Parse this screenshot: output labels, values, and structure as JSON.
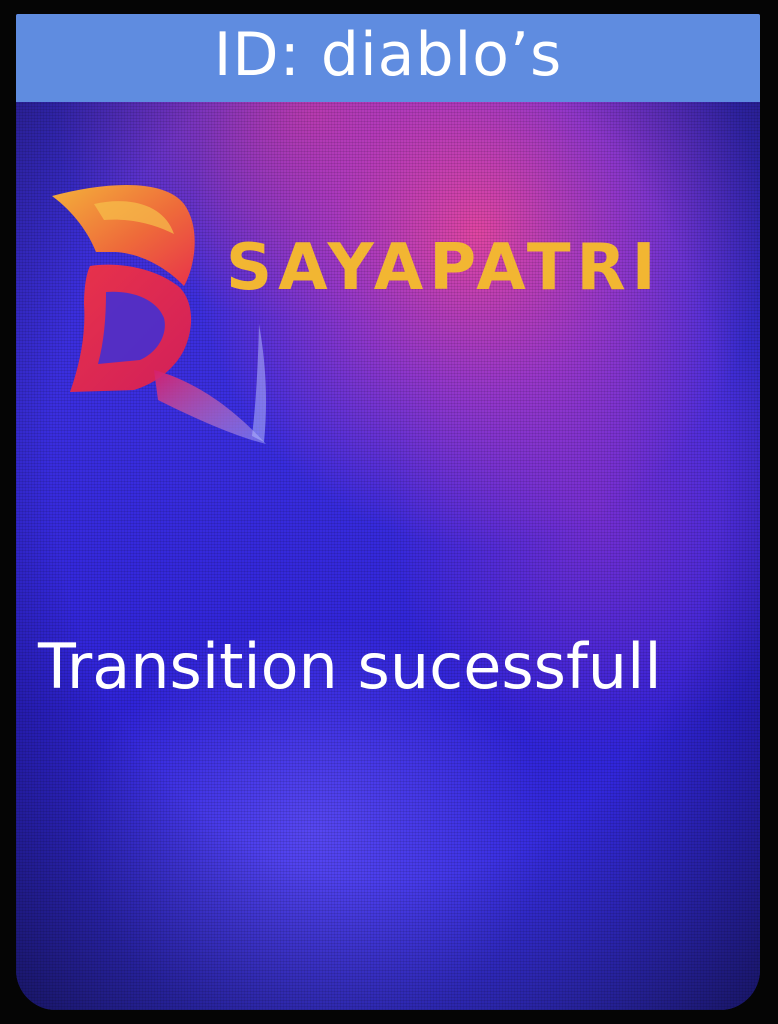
{
  "header": {
    "title": "ID: diablo’s"
  },
  "brand": {
    "name": "SAYAPATRI",
    "logo_icon": "sayapatri-logo-icon",
    "color": "#f2b632"
  },
  "status": {
    "message": "Transition sucessfull"
  },
  "colors": {
    "header_bar": "#5f8ce0",
    "screen_base": "#3a2ee0",
    "highlight_pink": "#e846a0"
  }
}
